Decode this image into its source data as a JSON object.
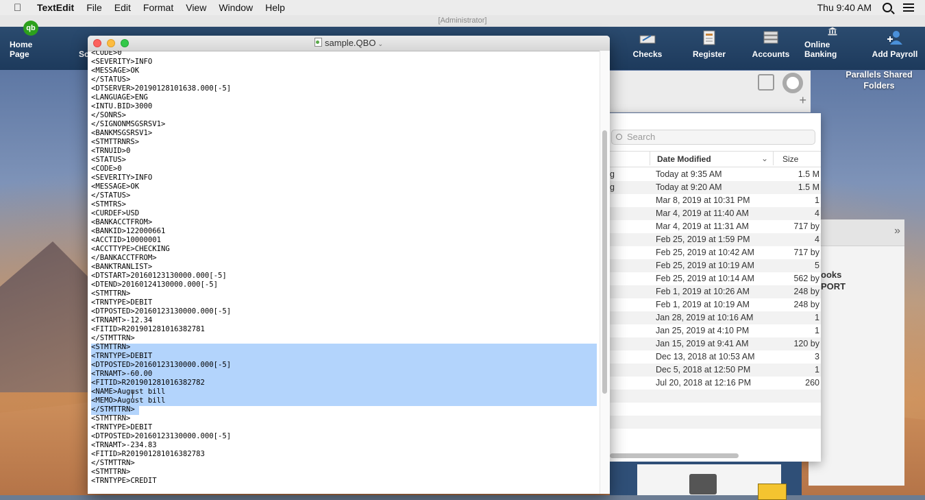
{
  "menubar": {
    "apple": "",
    "app_name": "TextEdit",
    "items": [
      "File",
      "Edit",
      "Format",
      "View",
      "Window",
      "Help"
    ],
    "clock": "Thu 9:40 AM"
  },
  "quickbooks": {
    "admin_label": "[Administrator]",
    "toolbar": {
      "home": "Home Page",
      "partial": "Sc",
      "checks": "Checks",
      "register": "Register",
      "accounts": "Accounts",
      "online_banking": "Online Banking",
      "add_payroll": "Add Payroll"
    },
    "logo": "qb"
  },
  "desktop": {
    "parallels": "Parallels Shared Folders"
  },
  "finder": {
    "search_placeholder": "Search",
    "columns": {
      "date": "Date Modified",
      "size": "Size"
    },
    "rows": [
      {
        "name": "g",
        "date": "Today at 9:35 AM",
        "size": "1.5 M"
      },
      {
        "name": "g",
        "date": "Today at 9:20 AM",
        "size": "1.5 M"
      },
      {
        "name": "",
        "date": "Mar 8, 2019 at 10:31 PM",
        "size": "1"
      },
      {
        "name": "",
        "date": "Mar 4, 2019 at 11:40 AM",
        "size": "4"
      },
      {
        "name": "",
        "date": "Mar 4, 2019 at 11:31 AM",
        "size": "717 by"
      },
      {
        "name": "",
        "date": "Feb 25, 2019 at 1:59 PM",
        "size": "4"
      },
      {
        "name": "",
        "date": "Feb 25, 2019 at 10:42 AM",
        "size": "717 by"
      },
      {
        "name": "",
        "date": "Feb 25, 2019 at 10:19 AM",
        "size": "5"
      },
      {
        "name": "",
        "date": "Feb 25, 2019 at 10:14 AM",
        "size": "562 by"
      },
      {
        "name": "",
        "date": "Feb 1, 2019 at 10:26 AM",
        "size": "248 by"
      },
      {
        "name": "",
        "date": "Feb 1, 2019 at 10:19 AM",
        "size": "248 by"
      },
      {
        "name": "",
        "date": "Jan 28, 2019 at 10:16 AM",
        "size": "1"
      },
      {
        "name": "",
        "date": "Jan 25, 2019 at 4:10 PM",
        "size": "1"
      },
      {
        "name": "",
        "date": "Jan 15, 2019 at 9:41 AM",
        "size": "120 by"
      },
      {
        "name": "",
        "date": "Dec 13, 2018 at 10:53 AM",
        "size": "3"
      },
      {
        "name": "",
        "date": "Dec 5, 2018 at 12:50 PM",
        "size": "1"
      },
      {
        "name": "",
        "date": "Jul 20, 2018 at 12:16 PM",
        "size": "260"
      }
    ]
  },
  "qb_panel": {
    "line1": "ooks",
    "line2": "PORT"
  },
  "textedit": {
    "title": "sample.QBO",
    "lines": [
      "<CODE>0",
      "<SEVERITY>INFO",
      "<MESSAGE>OK",
      "</STATUS>",
      "<DTSERVER>20190128101638.000[-5]",
      "<LANGUAGE>ENG",
      "<INTU.BID>3000",
      "</SONRS>",
      "</SIGNONMSGSRSV1>",
      "<BANKMSGSRSV1>",
      "<STMTTRNRS>",
      "<TRNUID>0",
      "<STATUS>",
      "<CODE>0",
      "<SEVERITY>INFO",
      "<MESSAGE>OK",
      "</STATUS>",
      "<STMTRS>",
      "<CURDEF>USD",
      "<BANKACCTFROM>",
      "<BANKID>122000661",
      "<ACCTID>10000001",
      "<ACCTTYPE>CHECKING",
      "</BANKACCTFROM>",
      "<BANKTRANLIST>",
      "<DTSTART>20160123130000.000[-5]",
      "<DTEND>20160124130000.000[-5]",
      "<STMTTRN>",
      "<TRNTYPE>DEBIT",
      "<DTPOSTED>20160123130000.000[-5]",
      "<TRNAMT>-12.34",
      "<FITID>R201901281016382781",
      "</STMTTRN>",
      "<STMTTRN>",
      "<TRNTYPE>DEBIT",
      "<DTPOSTED>20160123130000.000[-5]",
      "<TRNAMT>-60.00",
      "<FITID>R201901281016382782",
      "<NAME>August bill",
      "<MEMO>August bill",
      "</STMTTRN>",
      "<STMTTRN>",
      "<TRNTYPE>DEBIT",
      "<DTPOSTED>20160123130000.000[-5]",
      "<TRNAMT>-234.83",
      "<FITID>R201901281016382783",
      "</STMTTRN>",
      "<STMTTRN>",
      "<TRNTYPE>CREDIT"
    ]
  }
}
